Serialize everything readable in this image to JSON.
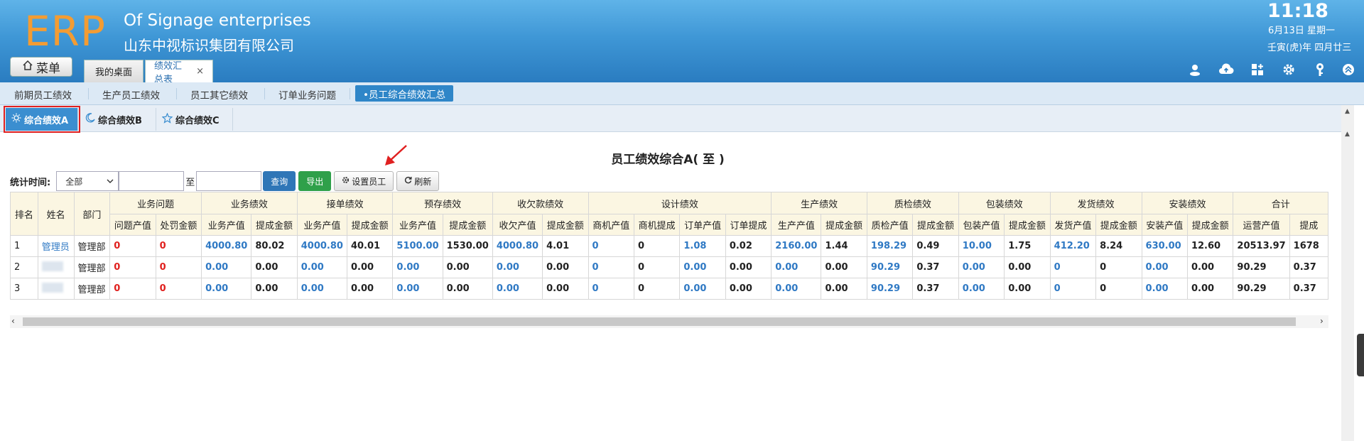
{
  "header": {
    "logo": "ERP",
    "company_en": "Of Signage enterprises",
    "company_cn": "山东中视标识集团有限公司",
    "time": "11:18",
    "date": "6月13日 星期一",
    "lunar": "壬寅(虎)年 四月廿三",
    "menu_label": "菜单",
    "tabs": [
      {
        "label": "我的桌面"
      },
      {
        "label": "绩效汇总表",
        "close": "×"
      }
    ],
    "icons": [
      "user-icon",
      "cloud-upload-icon",
      "grid-add-icon",
      "gear-icon",
      "key-icon",
      "collapse-icon"
    ]
  },
  "subnav": {
    "items": [
      "前期员工绩效",
      "生产员工绩效",
      "员工其它绩效",
      "订单业务问题"
    ],
    "active": "•员工综合绩效汇总"
  },
  "inner_tabs": [
    {
      "label": "综合绩效A",
      "icon": "sun-icon",
      "active": true
    },
    {
      "label": "综合绩效B",
      "icon": "moon-icon",
      "active": false
    },
    {
      "label": "综合绩效C",
      "icon": "star-icon",
      "active": false
    }
  ],
  "report": {
    "title": "员工绩效综合A( 至 )",
    "filter_label": "统计时间:",
    "period_value": "全部",
    "to_label": "至",
    "query_label": "查询",
    "export_label": "导出",
    "set_staff_label": "设置员工",
    "refresh_label": "刷新"
  },
  "table": {
    "fixed_headers": [
      "排名",
      "姓名",
      "部门"
    ],
    "groups": [
      {
        "label": "业务问题",
        "cols": [
          "问题产值",
          "处罚金额"
        ]
      },
      {
        "label": "业务绩效",
        "cols": [
          "业务产值",
          "提成金额"
        ]
      },
      {
        "label": "接单绩效",
        "cols": [
          "业务产值",
          "提成金额"
        ]
      },
      {
        "label": "预存绩效",
        "cols": [
          "业务产值",
          "提成金额"
        ]
      },
      {
        "label": "收欠款绩效",
        "cols": [
          "收欠产值",
          "提成金额"
        ]
      },
      {
        "label": "设计绩效",
        "cols": [
          "商机产值",
          "商机提成",
          "订单产值",
          "订单提成"
        ]
      },
      {
        "label": "生产绩效",
        "cols": [
          "生产产值",
          "提成金额"
        ]
      },
      {
        "label": "质检绩效",
        "cols": [
          "质检产值",
          "提成金额"
        ]
      },
      {
        "label": "包装绩效",
        "cols": [
          "包装产值",
          "提成金额"
        ]
      },
      {
        "label": "发货绩效",
        "cols": [
          "发货产值",
          "提成金额"
        ]
      },
      {
        "label": "安装绩效",
        "cols": [
          "安装产值",
          "提成金额"
        ]
      },
      {
        "label": "合计",
        "cols": [
          "运营产值",
          "提成"
        ]
      }
    ],
    "rows": [
      {
        "rank": "1",
        "name": "管理员",
        "dept": "管理部",
        "values": [
          "0",
          "0",
          "4000.80",
          "80.02",
          "4000.80",
          "40.01",
          "5100.00",
          "1530.00",
          "4000.80",
          "4.01",
          "0",
          "0",
          "1.08",
          "0.02",
          "2160.00",
          "1.44",
          "198.29",
          "0.49",
          "10.00",
          "1.75",
          "412.20",
          "8.24",
          "630.00",
          "12.60",
          "20513.97",
          "1678"
        ]
      },
      {
        "rank": "2",
        "name": "",
        "dept": "管理部",
        "values": [
          "0",
          "0",
          "0.00",
          "0.00",
          "0.00",
          "0.00",
          "0.00",
          "0.00",
          "0.00",
          "0.00",
          "0",
          "0",
          "0.00",
          "0.00",
          "0.00",
          "0.00",
          "90.29",
          "0.37",
          "0.00",
          "0.00",
          "0",
          "0",
          "0.00",
          "0.00",
          "90.29",
          "0.37"
        ]
      },
      {
        "rank": "3",
        "name": "",
        "dept": "管理部",
        "values": [
          "0",
          "0",
          "0.00",
          "0.00",
          "0.00",
          "0.00",
          "0.00",
          "0.00",
          "0.00",
          "0.00",
          "0",
          "0",
          "0.00",
          "0.00",
          "0.00",
          "0.00",
          "90.29",
          "0.37",
          "0.00",
          "0.00",
          "0",
          "0",
          "0.00",
          "0.00",
          "90.29",
          "0.37"
        ]
      }
    ],
    "value_styles": [
      "red",
      "red",
      "blue",
      "plain",
      "blue",
      "plain",
      "blue",
      "plain",
      "blue",
      "plain",
      "blue",
      "plain",
      "blue",
      "plain",
      "blue",
      "plain",
      "blue",
      "plain",
      "blue",
      "plain",
      "blue",
      "plain",
      "blue",
      "plain",
      "plain",
      "plain"
    ]
  },
  "colors": {
    "header_top": "#5fb3e8",
    "header_bottom": "#2a7cc0",
    "logo": "#f39c33",
    "active_tab": "#3b8ed0",
    "highlight_outline": "#e02020",
    "query_button": "#2f76b7",
    "export_button": "#2fa04a",
    "link_blue": "#2f79c4",
    "value_red": "#e0201e",
    "table_header_bg": "#fbf6e2"
  }
}
